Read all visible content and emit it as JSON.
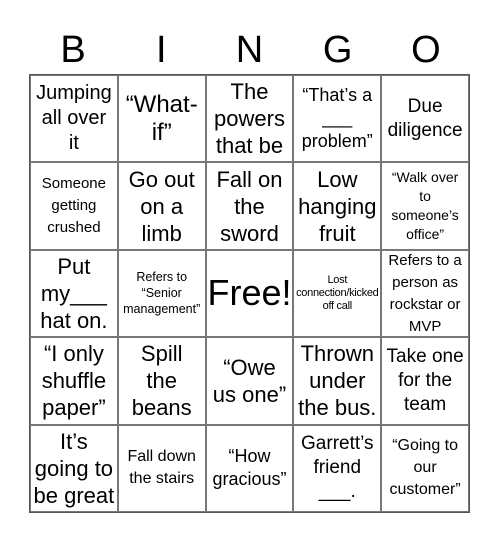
{
  "header": {
    "letters": [
      "B",
      "I",
      "N",
      "G",
      "O"
    ]
  },
  "cells": [
    [
      "Jumping\nall over\nit",
      "“What-\nif”",
      "The\npowers\nthat be",
      "“That’s a\n___\nproblem”",
      "Due\ndiligence"
    ],
    [
      "Someone\ngetting\ncrushed",
      "Go out\non a\nlimb",
      "Fall on\nthe\nsword",
      "Low\nhanging\nfruit",
      "“Walk over\nto\nsomeone’s\noffice”"
    ],
    [
      "Put\nmy___\nhat on.",
      "Refers to\n“Senior\nmanagement”",
      "Free!",
      "Lost\nconnection/kicked\noff call",
      "Refers to a\nperson as\nrockstar or\nMVP"
    ],
    [
      "“I only\nshuffle\npaper”",
      "Spill\nthe\nbeans",
      "“Owe\nus one”",
      "Thrown\nunder\nthe bus.",
      "Take one\nfor the\nteam"
    ],
    [
      "It’s\ngoing to\nbe great",
      "Fall down\nthe stairs",
      "“How\ngracious”",
      "Garrett’s\nfriend\n___.",
      "“Going to\nour\ncustomer”"
    ]
  ]
}
